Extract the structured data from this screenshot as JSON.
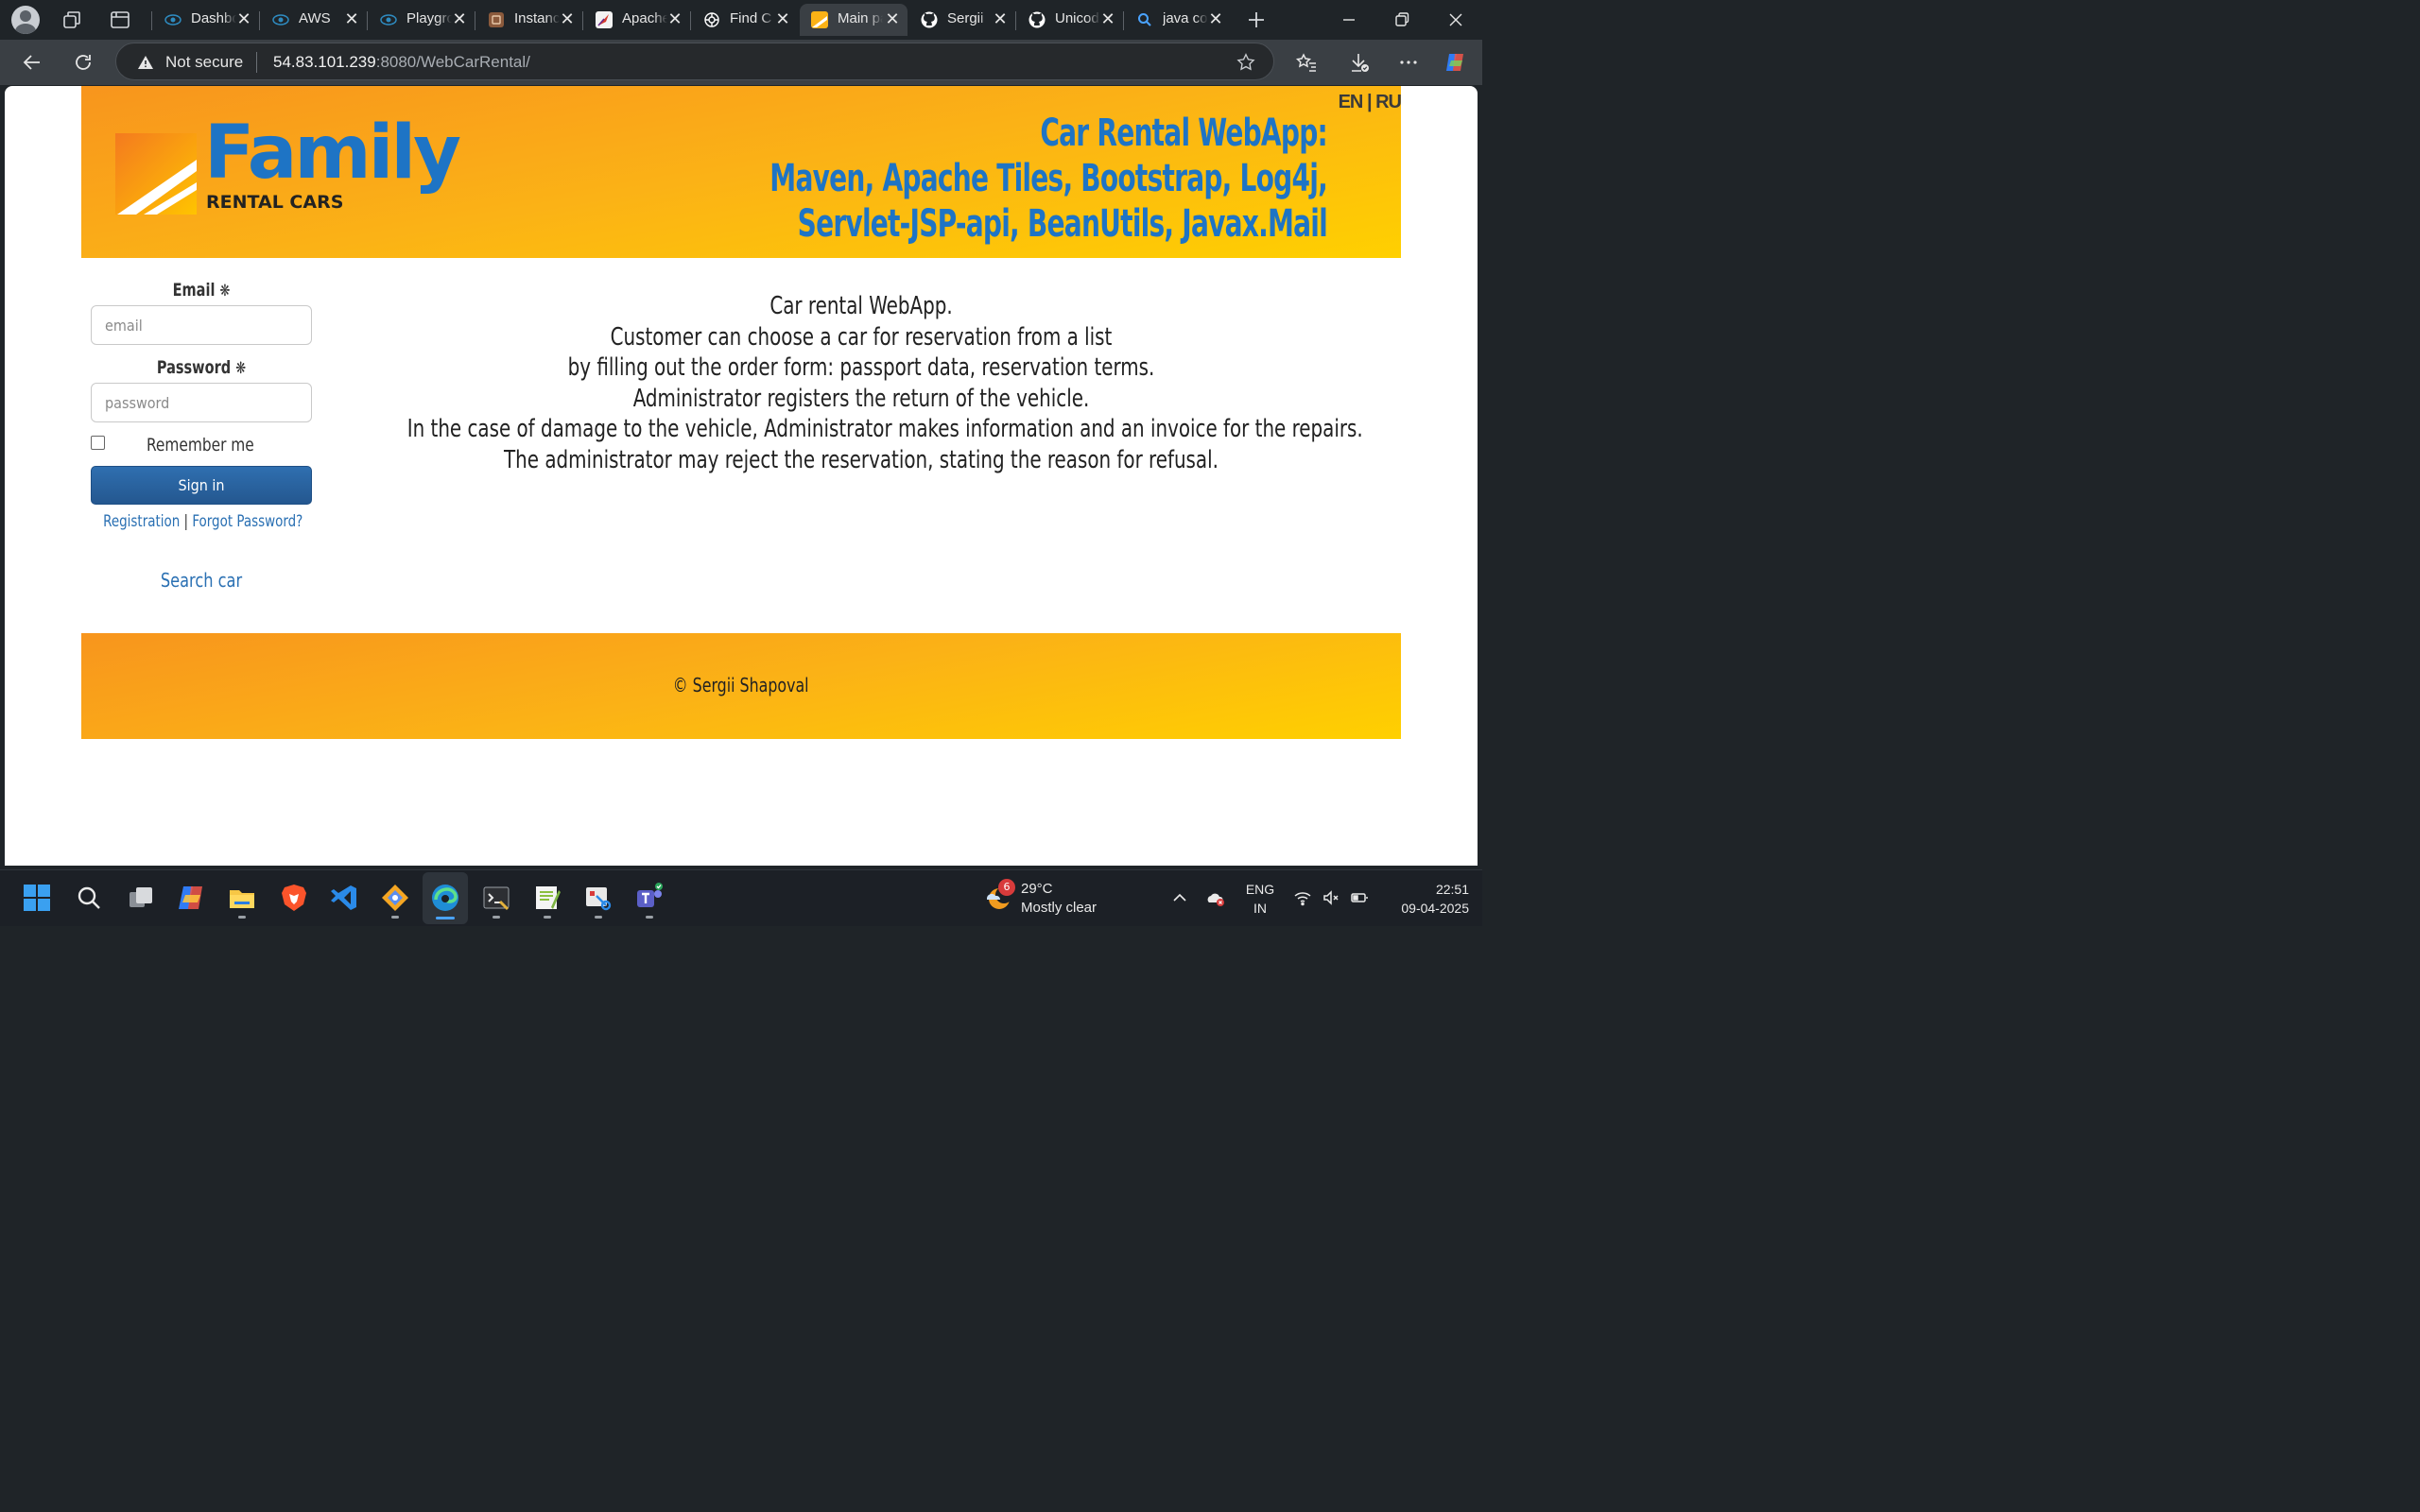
{
  "browser": {
    "tabs": [
      {
        "label": "Dashboard",
        "icon": "aws-eye-icon",
        "color": "#2e8bc0"
      },
      {
        "label": "AWS",
        "icon": "aws-eye-icon",
        "color": "#2e8bc0"
      },
      {
        "label": "Playground",
        "icon": "aws-eye-icon",
        "color": "#2e8bc0"
      },
      {
        "label": "Instances",
        "icon": "instances-icon",
        "color": "#8b5a3c"
      },
      {
        "label": "Apache",
        "icon": "apache-feather-icon",
        "color": "#d33a2c"
      },
      {
        "label": "Find C",
        "icon": "openai-icon",
        "color": "#ffffff"
      },
      {
        "label": "Main page",
        "icon": "family-logo-icon",
        "color": "#fbb216"
      },
      {
        "label": "Sergii",
        "icon": "github-icon",
        "color": "#ffffff"
      },
      {
        "label": "Unicode",
        "icon": "github-icon",
        "color": "#ffffff"
      },
      {
        "label": "java code",
        "icon": "search-icon",
        "color": "#4aa3ff"
      }
    ],
    "active_tab": 6,
    "security_label": "Not secure",
    "url_host": "54.83.101.239",
    "url_path": ":8080/WebCarRental/"
  },
  "site": {
    "lang_en": "EN",
    "lang_sep": " | ",
    "lang_ru": "RU",
    "logo_word": "Family",
    "logo_sub": "RENTAL CARS",
    "headline": [
      "Car Rental WebApp:",
      "Maven, Apache Tiles, Bootstrap, Log4j,",
      "Servlet-JSP-api, BeanUtils, Javax.Mail"
    ],
    "login": {
      "email_label": "Email",
      "email_placeholder": "email",
      "password_label": "Password",
      "password_placeholder": "password",
      "required_mark": "❋",
      "remember_label": "Remember me",
      "signin_label": "Sign in",
      "registration_link": "Registration",
      "link_sep": "|",
      "forgot_link": "Forgot Password?",
      "search_car_link": "Search car"
    },
    "description": [
      "Car rental WebApp.",
      "Customer can choose a car for reservation from a list",
      "by filling out the order form: passport data, reservation terms.",
      "Administrator registers the return of the vehicle.",
      "In the case of damage to the vehicle, Administrator makes information and an invoice for the repairs.",
      "The administrator may reject the reservation, stating the reason for refusal."
    ],
    "footer": "© Sergii Shapoval"
  },
  "taskbar": {
    "weather_badge": "6",
    "temperature": "29°C",
    "condition": "Mostly clear",
    "lang_line1": "ENG",
    "lang_line2": "IN",
    "time": "22:51",
    "date": "09-04-2025"
  }
}
